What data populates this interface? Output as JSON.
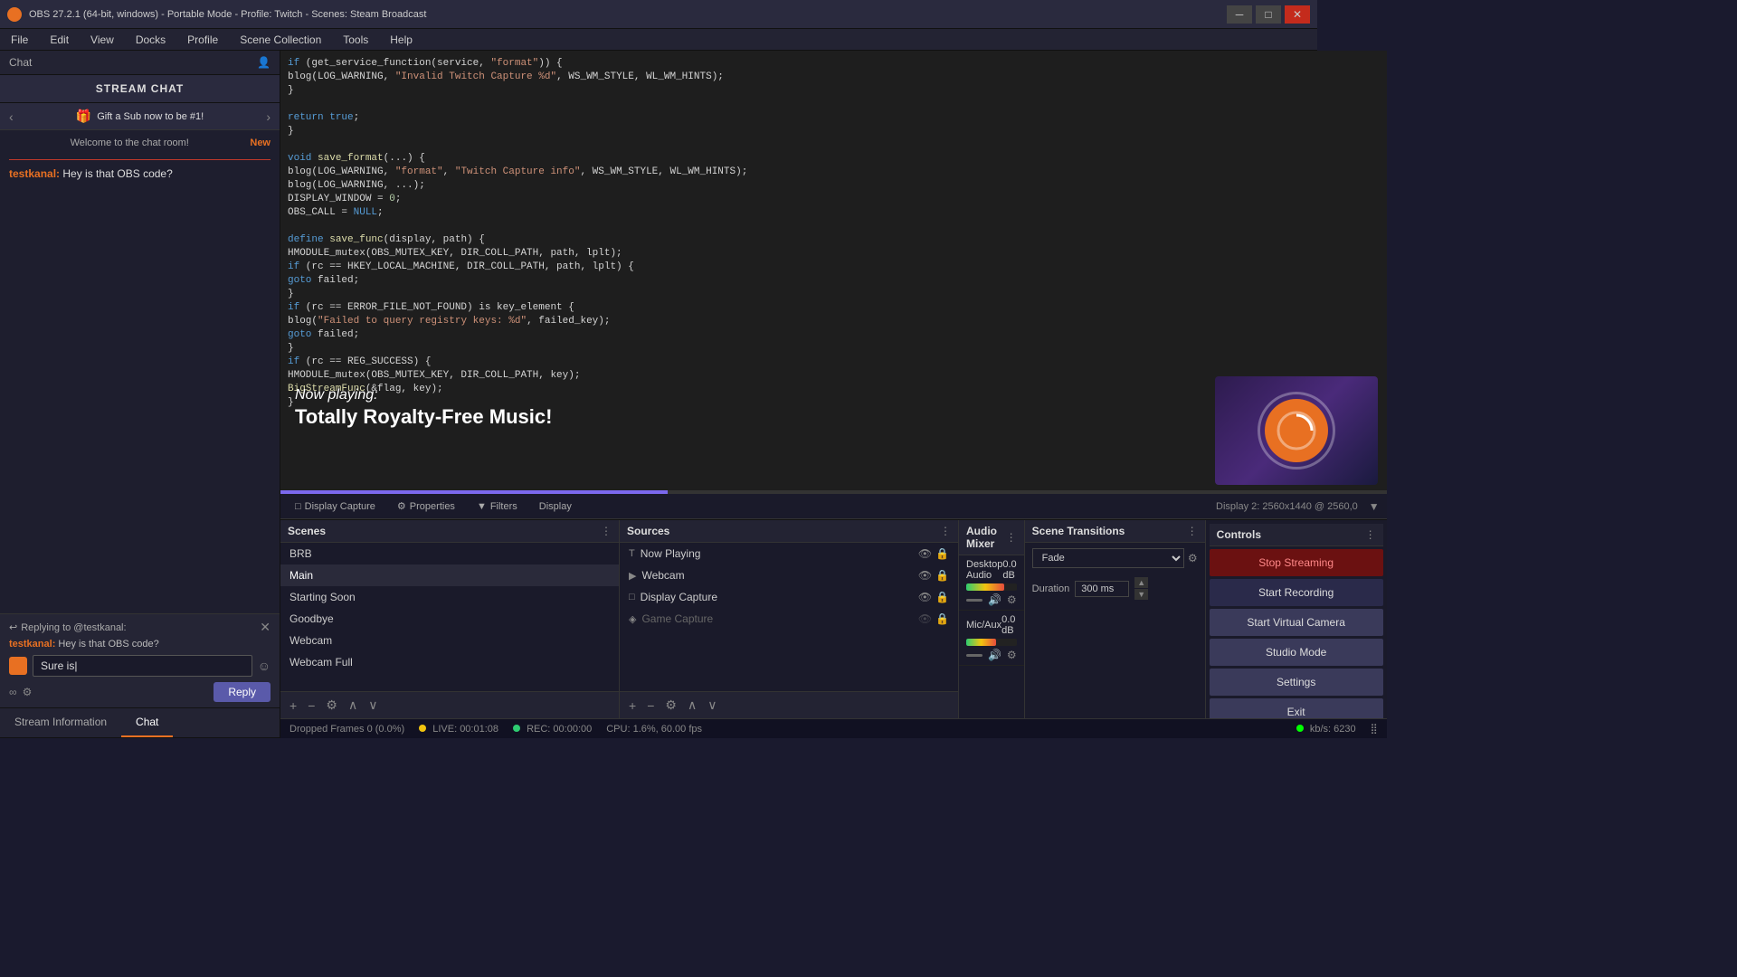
{
  "titlebar": {
    "title": "OBS 27.2.1 (64-bit, windows) - Portable Mode - Profile: Twitch - Scenes: Steam Broadcast",
    "icon": "●"
  },
  "menubar": {
    "items": [
      "File",
      "Edit",
      "View",
      "Docks",
      "Profile",
      "Scene Collection",
      "Tools",
      "Help"
    ]
  },
  "chat": {
    "panel_label": "Chat",
    "stream_chat_label": "STREAM CHAT",
    "gift_banner": "Gift a Sub now to be #1!",
    "welcome_msg": "Welcome to the chat room!",
    "new_badge": "New",
    "messages": [
      {
        "username": "testkanal:",
        "text": "Hey is that OBS code?"
      }
    ],
    "reply": {
      "replying_to": "Replying to @testkanal:",
      "quoted_username": "testkanal:",
      "quoted_text": "Hey is that OBS code?",
      "input_value": "Sure is|",
      "reply_btn": "Reply"
    },
    "tabs": {
      "stream_information": "Stream Information",
      "chat": "Chat"
    }
  },
  "preview": {
    "now_playing_label": "Now playing:",
    "now_playing_title": "Totally Royalty-Free Music!",
    "progress_width": "35"
  },
  "display_toolbar": {
    "display_capture_label": "Display Capture",
    "properties_label": "Properties",
    "filters_label": "Filters",
    "display_label": "Display",
    "display_info": "Display 2: 2560x1440 @ 2560,0"
  },
  "scenes": {
    "panel_title": "Scenes",
    "items": [
      "BRB",
      "Main",
      "Starting Soon",
      "Goodbye",
      "Webcam",
      "Webcam Full"
    ],
    "active": "Main"
  },
  "sources": {
    "panel_title": "Sources",
    "items": [
      {
        "name": "Now Playing",
        "icon": "T",
        "visible": true,
        "locked": true
      },
      {
        "name": "Webcam",
        "icon": "▶",
        "visible": true,
        "locked": true
      },
      {
        "name": "Display Capture",
        "icon": "□",
        "visible": true,
        "locked": true
      },
      {
        "name": "Game Capture",
        "icon": "◈",
        "visible": false,
        "locked": true,
        "muted": true
      }
    ]
  },
  "audio": {
    "panel_title": "Audio Mixer",
    "tracks": [
      {
        "name": "Desktop Audio",
        "db": "0.0 dB",
        "meter_width": 75
      },
      {
        "name": "Mic/Aux",
        "db": "0.0 dB",
        "meter_width": 60
      }
    ]
  },
  "transitions": {
    "panel_title": "Scene Transitions",
    "current": "Fade",
    "duration_label": "Duration",
    "duration_value": "300 ms"
  },
  "controls": {
    "panel_title": "Controls",
    "buttons": {
      "stop_streaming": "Stop Streaming",
      "start_recording": "Start Recording",
      "start_virtual_camera": "Start Virtual Camera",
      "studio_mode": "Studio Mode",
      "settings": "Settings",
      "exit": "Exit"
    }
  },
  "statusbar": {
    "dropped_frames": "Dropped Frames 0 (0.0%)",
    "live": "LIVE: 00:01:08",
    "rec": "REC: 00:00:00",
    "cpu": "CPU: 1.6%, 60.00 fps",
    "kbps": "kb/s: 6230"
  },
  "code_lines": [
    {
      "content": "  if (get_service_function(service, \"format\")) {",
      "classes": "cmt"
    },
    {
      "content": "    blog(LOG_WARNING, \"Invalid Twitch Capture %d\", WS_WM_STYLE, WL_WM_HINTS);",
      "classes": ""
    },
    {
      "content": "  }",
      "classes": ""
    },
    {
      "content": "",
      "classes": ""
    },
    {
      "content": "  return true;",
      "classes": "kw"
    },
    {
      "content": "}",
      "classes": ""
    },
    {
      "content": "",
      "classes": ""
    },
    {
      "content": "void save_format(...) {",
      "classes": "fn"
    },
    {
      "content": "  blog(LOG_WARNING, \"format\", \"Twitch Capture info\", WS_WM_STYLE, WL_WM_HINTS);",
      "classes": ""
    },
    {
      "content": "  blog(LOG_WARNING, ...);",
      "classes": ""
    },
    {
      "content": "  DISPLAY_WINDOW = 0;",
      "classes": ""
    },
    {
      "content": "  OBS_CALL = NULL;",
      "classes": ""
    },
    {
      "content": "",
      "classes": ""
    },
    {
      "content": "  define save_func(display, path) {",
      "classes": "kw"
    },
    {
      "content": "    HMODULE_mutex(OBS_MUTEX_KEY, DIR_COLL_PATH, path, lplt);",
      "classes": ""
    },
    {
      "content": "    if (rc == HKEY_LOCAL_MACHINE, DIR_COLL_PATH, path, lplt) {",
      "classes": ""
    },
    {
      "content": "      goto failed;",
      "classes": "kw"
    },
    {
      "content": "    }",
      "classes": ""
    },
    {
      "content": "    if (rc == ERROR_FILE_NOT_FOUND) is key_element {",
      "classes": ""
    },
    {
      "content": "      blog(\"Failed to query registry keys: %d\", failed_key);",
      "classes": ""
    },
    {
      "content": "      goto failed;",
      "classes": "kw"
    },
    {
      "content": "    }",
      "classes": ""
    },
    {
      "content": "    if (rc == REG_SUCCESS) {",
      "classes": ""
    },
    {
      "content": "      HMODULE_mutex(OBS_MUTEX_KEY, DIR_COLL_PATH, key);",
      "classes": ""
    },
    {
      "content": "      BigStreamFunc(&flag, key);",
      "classes": "fn"
    },
    {
      "content": "    }",
      "classes": ""
    }
  ]
}
